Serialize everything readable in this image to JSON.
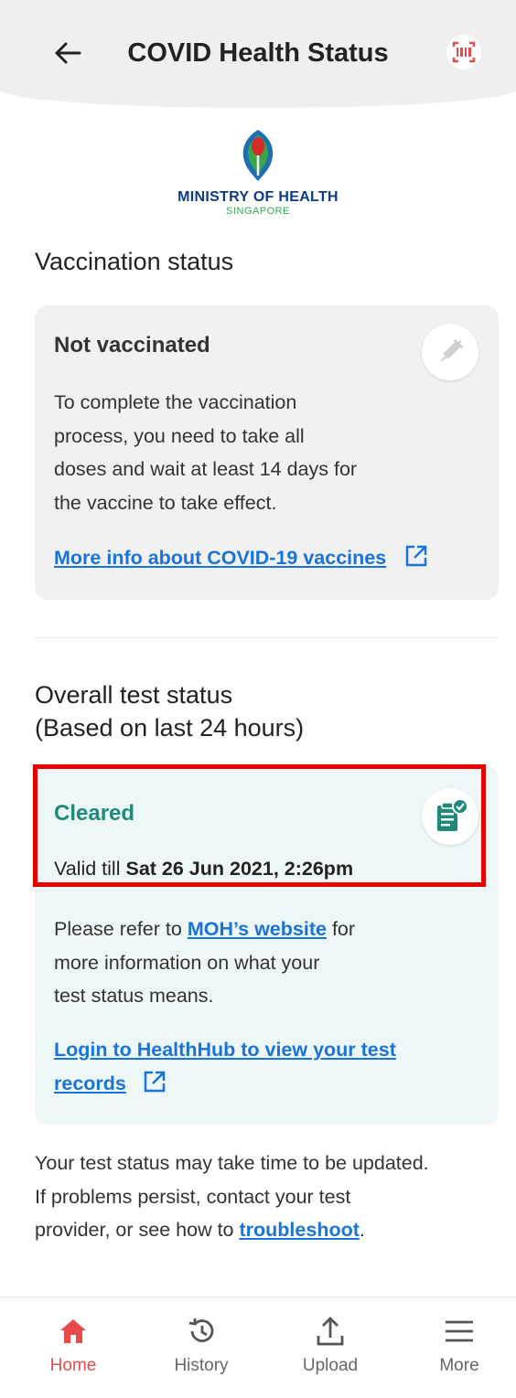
{
  "header": {
    "title": "COVID Health Status",
    "back_icon": "arrow-left-icon",
    "qr_icon": "qr-scan-icon"
  },
  "logo": {
    "name": "MINISTRY OF HEALTH",
    "sub": "SINGAPORE"
  },
  "vaccination": {
    "heading": "Vaccination status",
    "status": "Not vaccinated",
    "description_lines": [
      "To complete the vaccination",
      "process, you need to take all",
      "doses and wait at least 14 days for",
      "the vaccine to take effect."
    ],
    "link_label": "More info about COVID-19 vaccines",
    "icon": "syringe-icon"
  },
  "test": {
    "heading_line1": "Overall test status",
    "heading_line2": "(Based on last 24 hours)",
    "status": "Cleared",
    "valid_prefix": "Valid till",
    "valid_date": "Sat 26 Jun 2021, 2:26pm",
    "refer_prefix": "Please refer to",
    "refer_link": "MOH’s website",
    "refer_suffix": "for",
    "refer_line2": "more information on what your",
    "refer_line3": "test status means.",
    "healthhub_line1": "Login to HealthHub to view your test",
    "healthhub_line2": "records",
    "icon": "clipboard-check-icon"
  },
  "footnote": {
    "line1": "Your test status may take time to be updated.",
    "line2": "If problems persist, contact your test",
    "line3_prefix": "provider, or see how to",
    "link": "troubleshoot",
    "line3_suffix": "."
  },
  "nav": {
    "items": [
      {
        "label": "Home",
        "icon": "home-icon",
        "active": true
      },
      {
        "label": "History",
        "icon": "history-icon",
        "active": false
      },
      {
        "label": "Upload",
        "icon": "upload-icon",
        "active": false
      },
      {
        "label": "More",
        "icon": "menu-icon",
        "active": false
      }
    ]
  },
  "colors": {
    "accent": "#e84b4b",
    "cleared": "#1f8a7a",
    "link": "#1a73d9",
    "highlight_border": "#e80000"
  }
}
